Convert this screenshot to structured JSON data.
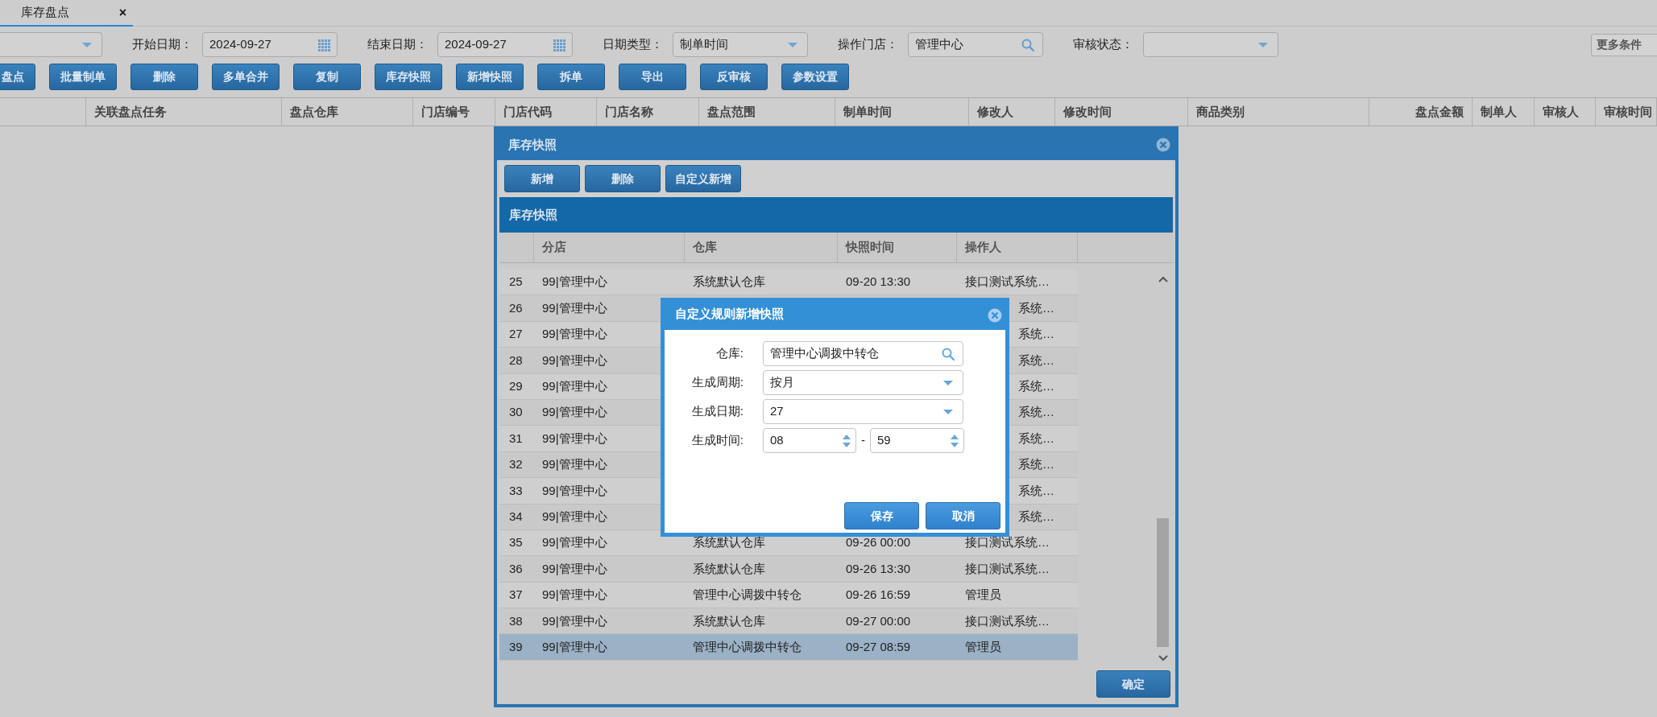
{
  "tab": {
    "label": "库存盘点",
    "close": "×",
    "selected": true
  },
  "filters": [
    {
      "kind": "select"
    },
    {
      "kind": "date",
      "label": "开始日期：",
      "value": "2024-09-27"
    },
    {
      "kind": "date",
      "label": "结束日期：",
      "value": "2024-09-27"
    },
    {
      "kind": "select",
      "label": "日期类型：",
      "value": "制单时间"
    },
    {
      "kind": "lookup",
      "label": "操作门店：",
      "value": "管理中心"
    },
    {
      "kind": "select",
      "label": "审核状态："
    }
  ],
  "more_conditions": "更多条件",
  "toolbar": [
    "盘点",
    "批量制单",
    "删除",
    "多单合并",
    "复制",
    "库存快照",
    "新增快照",
    "拆单",
    "导出",
    "反审核",
    "参数设置"
  ],
  "columns": [
    "",
    "关联盘点任务",
    "盘点仓库",
    "门店编号",
    "门店代码",
    "门店名称",
    "盘点范围",
    "制单时间",
    "修改人",
    "修改时间",
    "商品类别",
    "盘点金额",
    "制单人",
    "审核人",
    "审核时间"
  ],
  "snapshot_dialog": {
    "title": "库存快照",
    "buttons": [
      "新增",
      "删除",
      "自定义新增"
    ],
    "grid_title": "库存快照",
    "columns": [
      "分店",
      "仓库",
      "快照时间",
      "操作人"
    ],
    "rows": [
      {
        "no": "25",
        "store": "99|管理中心",
        "warehouse": "系统默认仓库",
        "time": "09-20 13:30",
        "operator": "接口测试系统…",
        "selected": false
      },
      {
        "no": "26",
        "store": "99|管理中心",
        "operator": "系统…",
        "selected": false
      },
      {
        "no": "27",
        "store": "99|管理中心",
        "operator": "系统…",
        "selected": false
      },
      {
        "no": "28",
        "store": "99|管理中心",
        "operator": "系统…",
        "selected": false
      },
      {
        "no": "29",
        "store": "99|管理中心",
        "operator": "系统…",
        "selected": false
      },
      {
        "no": "30",
        "store": "99|管理中心",
        "operator": "系统…",
        "selected": false
      },
      {
        "no": "31",
        "store": "99|管理中心",
        "operator": "系统…",
        "selected": false
      },
      {
        "no": "32",
        "store": "99|管理中心",
        "operator": "系统…",
        "selected": false
      },
      {
        "no": "33",
        "store": "99|管理中心",
        "operator": "系统…",
        "selected": false
      },
      {
        "no": "34",
        "store": "99|管理中心",
        "operator": "系统…",
        "selected": false
      },
      {
        "no": "35",
        "store": "99|管理中心",
        "warehouse": "系统默认仓库",
        "time": "09-26 00:00",
        "operator": "接口测试系统…",
        "selected": false
      },
      {
        "no": "36",
        "store": "99|管理中心",
        "warehouse": "系统默认仓库",
        "time": "09-26 13:30",
        "operator": "接口测试系统…",
        "selected": false
      },
      {
        "no": "37",
        "store": "99|管理中心",
        "warehouse": "管理中心调拨中转仓",
        "time": "09-26 16:59",
        "operator": "管理员",
        "selected": false
      },
      {
        "no": "38",
        "store": "99|管理中心",
        "warehouse": "系统默认仓库",
        "time": "09-27 00:00",
        "operator": "接口测试系统…",
        "selected": false
      },
      {
        "no": "39",
        "store": "99|管理中心",
        "warehouse": "管理中心调拨中转仓",
        "time": "09-27 08:59",
        "operator": "管理员",
        "selected": true
      }
    ],
    "ok": "确定"
  },
  "rule_dialog": {
    "title": "自定义规则新增快照",
    "fields": [
      {
        "kind": "lookup",
        "label": "仓库:",
        "value": "管理中心调拨中转仓"
      },
      {
        "kind": "select",
        "label": "生成周期:",
        "value": "按月"
      },
      {
        "kind": "select",
        "label": "生成日期:",
        "value": "27"
      },
      {
        "kind": "time",
        "label": "生成时间:",
        "hour": "08",
        "separator": "-",
        "minute": "59"
      }
    ],
    "buttons": [
      "保存",
      "取消"
    ]
  }
}
